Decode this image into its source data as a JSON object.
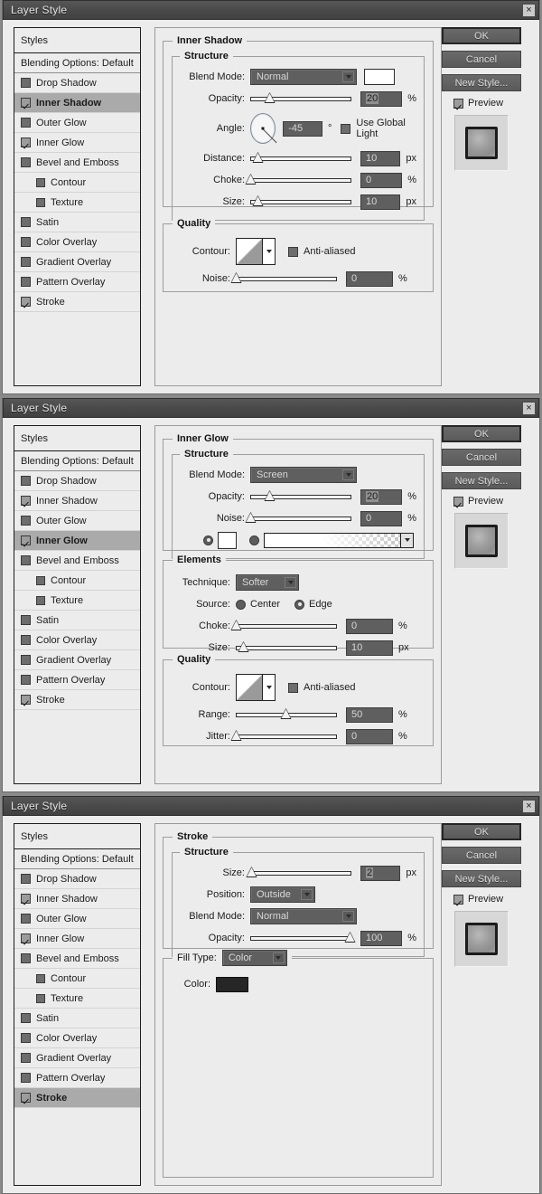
{
  "window": {
    "title": "Layer Style",
    "close_label": "×"
  },
  "styles_panel": {
    "header": "Styles",
    "blending_options": "Blending Options: Default",
    "items": [
      {
        "label": "Drop Shadow",
        "checked": false,
        "sub": false
      },
      {
        "label": "Inner Shadow",
        "checked": true,
        "sub": false
      },
      {
        "label": "Outer Glow",
        "checked": false,
        "sub": false
      },
      {
        "label": "Inner Glow",
        "checked": true,
        "sub": false
      },
      {
        "label": "Bevel and Emboss",
        "checked": false,
        "sub": false
      },
      {
        "label": "Contour",
        "checked": false,
        "sub": true
      },
      {
        "label": "Texture",
        "checked": false,
        "sub": true
      },
      {
        "label": "Satin",
        "checked": false,
        "sub": false
      },
      {
        "label": "Color Overlay",
        "checked": false,
        "sub": false
      },
      {
        "label": "Gradient Overlay",
        "checked": false,
        "sub": false
      },
      {
        "label": "Pattern Overlay",
        "checked": false,
        "sub": false
      },
      {
        "label": "Stroke",
        "checked": true,
        "sub": false
      }
    ],
    "selected_1": "Inner Shadow",
    "selected_2": "Inner Glow",
    "selected_3": "Stroke"
  },
  "buttons": {
    "ok": "OK",
    "cancel": "Cancel",
    "new_style": "New Style...",
    "preview": "Preview",
    "preview_checked": true
  },
  "panel1": {
    "title": "Inner Shadow",
    "structure": {
      "title": "Structure",
      "blend_mode_label": "Blend Mode:",
      "blend_mode_value": "Normal",
      "color_swatch": "#ffffff",
      "opacity_label": "Opacity:",
      "opacity_value": "20",
      "opacity_unit": "%",
      "opacity_pct": 20,
      "angle_label": "Angle:",
      "angle_value": "-45",
      "angle_unit": "°",
      "use_global_light": "Use Global Light",
      "use_global_light_checked": false,
      "distance_label": "Distance:",
      "distance_value": "10",
      "distance_unit": "px",
      "distance_pct": 8,
      "choke_label": "Choke:",
      "choke_value": "0",
      "choke_unit": "%",
      "choke_pct": 0,
      "size_label": "Size:",
      "size_value": "10",
      "size_unit": "px",
      "size_pct": 8
    },
    "quality": {
      "title": "Quality",
      "contour_label": "Contour:",
      "anti_aliased_label": "Anti-aliased",
      "anti_aliased_checked": false,
      "noise_label": "Noise:",
      "noise_value": "0",
      "noise_unit": "%",
      "noise_pct": 0
    }
  },
  "panel2": {
    "title": "Inner Glow",
    "structure": {
      "title": "Structure",
      "blend_mode_label": "Blend Mode:",
      "blend_mode_value": "Screen",
      "opacity_label": "Opacity:",
      "opacity_value": "20",
      "opacity_unit": "%",
      "opacity_pct": 20,
      "noise_label": "Noise:",
      "noise_value": "0",
      "noise_unit": "%",
      "noise_pct": 0,
      "fill_color_selected": true,
      "fill_gradient_selected": false,
      "color_swatch": "#ffffff"
    },
    "elements": {
      "title": "Elements",
      "technique_label": "Technique:",
      "technique_value": "Softer",
      "source_label": "Source:",
      "source_center": "Center",
      "source_edge": "Edge",
      "source_selected": "Edge",
      "choke_label": "Choke:",
      "choke_value": "0",
      "choke_unit": "%",
      "choke_pct": 0,
      "size_label": "Size:",
      "size_value": "10",
      "size_unit": "px",
      "size_pct": 8
    },
    "quality": {
      "title": "Quality",
      "contour_label": "Contour:",
      "anti_aliased_label": "Anti-aliased",
      "anti_aliased_checked": false,
      "range_label": "Range:",
      "range_value": "50",
      "range_unit": "%",
      "range_pct": 50,
      "jitter_label": "Jitter:",
      "jitter_value": "0",
      "jitter_unit": "%",
      "jitter_pct": 0
    }
  },
  "panel3": {
    "title": "Stroke",
    "structure": {
      "title": "Structure",
      "size_label": "Size:",
      "size_value": "2",
      "size_unit": "px",
      "size_pct": 2,
      "position_label": "Position:",
      "position_value": "Outside",
      "blend_mode_label": "Blend Mode:",
      "blend_mode_value": "Normal",
      "opacity_label": "Opacity:",
      "opacity_value": "100",
      "opacity_unit": "%",
      "opacity_pct": 100
    },
    "fill": {
      "title": "Fill Type:",
      "fill_type_value": "Color",
      "color_label": "Color:",
      "color_swatch": "#262626"
    }
  }
}
